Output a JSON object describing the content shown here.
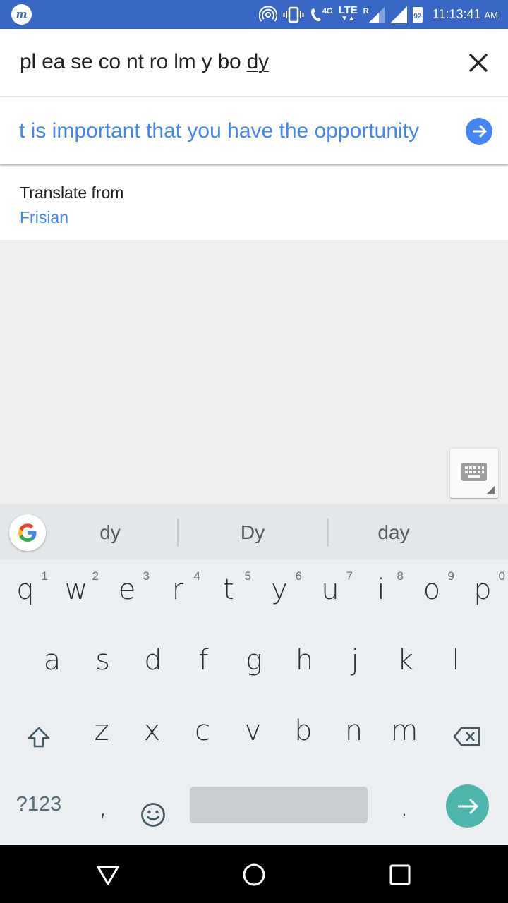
{
  "status_bar": {
    "app_icon": "m-logo-icon",
    "network_4g": "4G",
    "network_lte": "LTE",
    "roaming": "R",
    "battery_level": "92",
    "time": "11:13:41",
    "ampm": "AM"
  },
  "input": {
    "source_text": "pl ea se co nt ro lm y bo ",
    "composing_text": "dy",
    "clear_icon": "close-icon"
  },
  "result": {
    "translated_text": "t is important that you have the opportunity",
    "go_icon": "arrow-right-circle-icon"
  },
  "language": {
    "label": "Translate from",
    "value": "Frisian"
  },
  "keyboard": {
    "suggestions": [
      "dy",
      "Dy",
      "day"
    ],
    "row1": [
      {
        "key": "q",
        "hint": "1"
      },
      {
        "key": "w",
        "hint": "2"
      },
      {
        "key": "e",
        "hint": "3"
      },
      {
        "key": "r",
        "hint": "4"
      },
      {
        "key": "t",
        "hint": "5"
      },
      {
        "key": "y",
        "hint": "6"
      },
      {
        "key": "u",
        "hint": "7"
      },
      {
        "key": "i",
        "hint": "8"
      },
      {
        "key": "o",
        "hint": "9"
      },
      {
        "key": "p",
        "hint": "0"
      }
    ],
    "row2": [
      "a",
      "s",
      "d",
      "f",
      "g",
      "h",
      "j",
      "k",
      "l"
    ],
    "row3": [
      "z",
      "x",
      "c",
      "v",
      "b",
      "n",
      "m"
    ],
    "symbols_label": "?123",
    "comma": ",",
    "period": ".",
    "colors": {
      "enter": "#4db6ac",
      "accent": "#4285f4",
      "status_bar": "#3867c5"
    }
  }
}
